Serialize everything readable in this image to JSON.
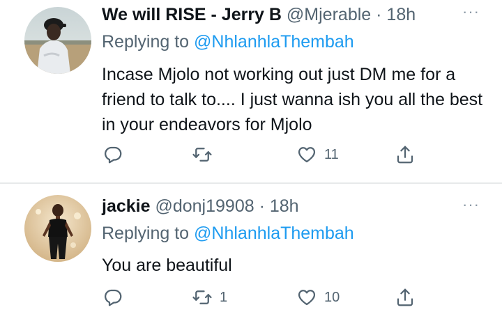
{
  "tweets": [
    {
      "display_name": "We will RISE - Jerry B",
      "handle": "@Mjerable",
      "separator": "·",
      "time": "18h",
      "replying_prefix": "Replying to",
      "replying_to": "@NhlanhlaThembah",
      "text": "Incase Mjolo not working out just DM me for a friend to talk to.... I just wanna ish you all the best in your endeavors for Mjolo",
      "retweets": "",
      "likes": "11"
    },
    {
      "display_name": "jackie",
      "handle": "@donj19908",
      "separator": "·",
      "time": "18h",
      "replying_prefix": "Replying to",
      "replying_to": "@NhlanhlaThembah",
      "text": "You are beautiful",
      "retweets": "1",
      "likes": "10"
    }
  ],
  "more_glyph": "···",
  "icons": {
    "reply": "comment-icon",
    "retweet": "retweet-icon",
    "like": "heart-icon",
    "share": "share-icon",
    "more": "more-options-icon"
  },
  "colors": {
    "text": "#0f1419",
    "secondary": "#536471",
    "link": "#1d9bf0",
    "divider": "#e7e9ea"
  }
}
